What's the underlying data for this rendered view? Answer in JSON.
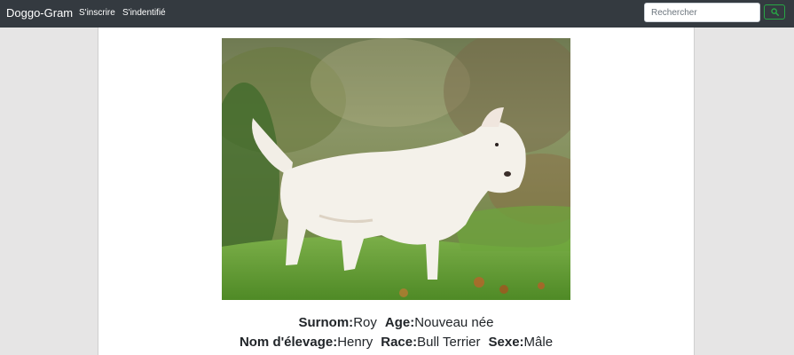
{
  "navbar": {
    "brand": "Doggo-Gram",
    "links": [
      {
        "label": "S'inscrire"
      },
      {
        "label": "S'indentifié"
      }
    ],
    "search": {
      "placeholder": "Rechercher",
      "value": ""
    }
  },
  "dog": {
    "nickname_label": "Surnom:",
    "nickname": "Roy",
    "age_label": "Age:",
    "age": "Nouveau née",
    "breeding_name_label": "Nom d'élevage:",
    "breeding_name": "Henry",
    "breed_label": "Race:",
    "breed": "Bull Terrier",
    "sex_label": "Sexe:",
    "sex": "Mâle"
  },
  "colors": {
    "navbar_bg": "#343a40",
    "page_bg": "#e6e5e5",
    "search_accent": "#28a745"
  },
  "icons": {
    "search": "search-icon"
  }
}
